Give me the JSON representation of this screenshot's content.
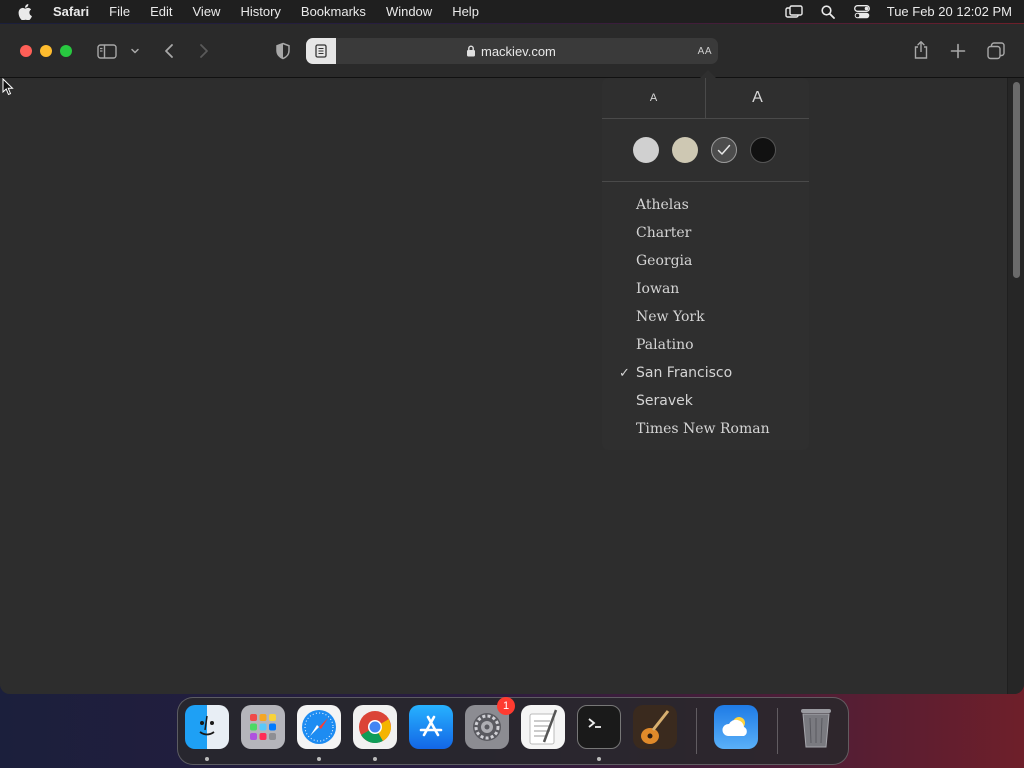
{
  "menubar": {
    "app_name": "Safari",
    "items": [
      "File",
      "Edit",
      "View",
      "History",
      "Bookmarks",
      "Window",
      "Help"
    ],
    "clock": "Tue Feb 20  12:02 PM",
    "right_icons": [
      "screen-mirroring-icon",
      "spotlight-search-icon",
      "control-center-icon"
    ]
  },
  "toolbar": {
    "url": "mackiev.com",
    "text_size_label": "AA",
    "secure": true
  },
  "reader_popover": {
    "size_small_label": "A",
    "size_large_label": "A",
    "themes": [
      {
        "name": "white",
        "color": "#d0d0d0",
        "selected": false
      },
      {
        "name": "sepia",
        "color": "#cec8b3",
        "selected": false
      },
      {
        "name": "gray",
        "color": "#5a5a5a",
        "selected": true
      },
      {
        "name": "night",
        "color": "#111111",
        "selected": false
      }
    ],
    "fonts": [
      {
        "label": "Athelas",
        "selected": false,
        "sans": false
      },
      {
        "label": "Charter",
        "selected": false,
        "sans": false
      },
      {
        "label": "Georgia",
        "selected": false,
        "sans": false
      },
      {
        "label": "Iowan",
        "selected": false,
        "sans": false
      },
      {
        "label": "New York",
        "selected": false,
        "sans": false
      },
      {
        "label": "Palatino",
        "selected": false,
        "sans": false
      },
      {
        "label": "San Francisco",
        "selected": true,
        "sans": true
      },
      {
        "label": "Seravek",
        "selected": false,
        "sans": true
      },
      {
        "label": "Times New Roman",
        "selected": false,
        "sans": false
      }
    ],
    "check_mark": "✓"
  },
  "dock": {
    "apps": [
      "finder",
      "launchpad",
      "safari",
      "chrome",
      "app-store",
      "system-settings",
      "textedit",
      "terminal",
      "garageband",
      "weather",
      "trash"
    ],
    "system_settings_badge": "1"
  }
}
